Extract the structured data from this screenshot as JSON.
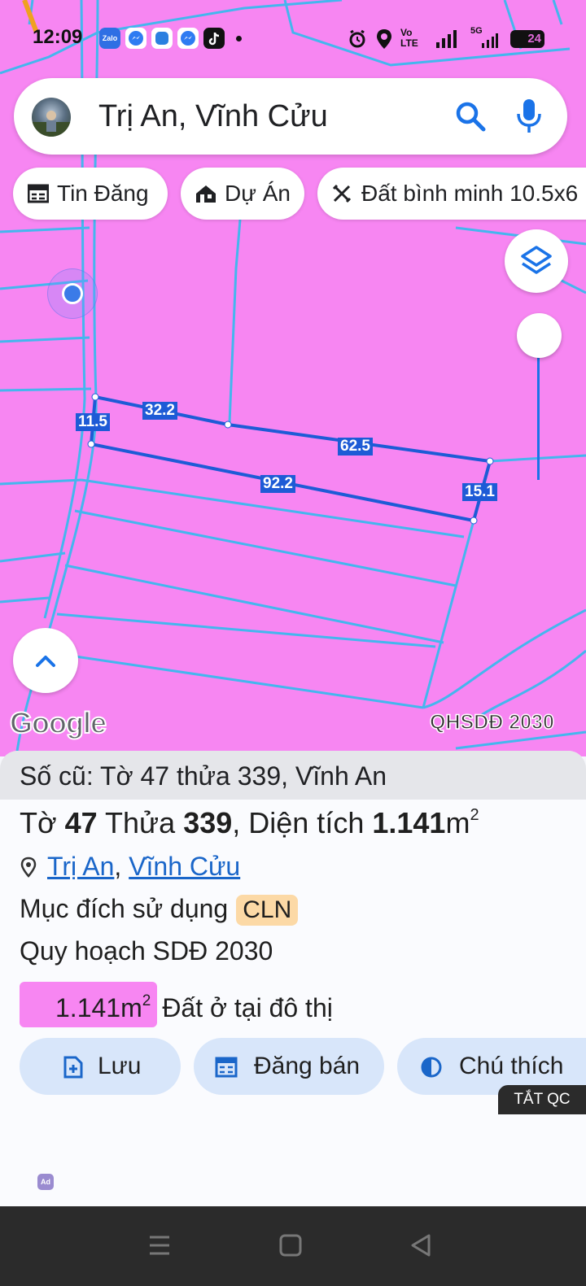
{
  "status_bar": {
    "time": "12:09",
    "apps": [
      "Zalo",
      "messenger-icon",
      "blue-app-icon",
      "messenger-icon",
      "tiktok-icon"
    ],
    "network": "Vo LTE",
    "network2": "5G",
    "battery": "24"
  },
  "search": {
    "query": "Trị An, Vĩnh Cửu"
  },
  "chips": [
    {
      "label": "Tin Đăng",
      "icon": "listing-icon"
    },
    {
      "label": "Dự Án",
      "icon": "project-icon"
    },
    {
      "label": "Đất bình minh 10.5x6",
      "icon": "ruler-icon"
    }
  ],
  "map": {
    "dimensions": [
      "11.5",
      "32.2",
      "62.5",
      "92.2",
      "15.1"
    ],
    "attribution": "Google",
    "overlay_label": "QHSDĐ 2030",
    "colors": {
      "land": "#f786f2",
      "parcel_line": "#44b6ee",
      "selected": "#1e5bd6"
    }
  },
  "sheet": {
    "old_number": "Số cũ: Tờ 47 thửa 339, Vĩnh An",
    "title": {
      "sheet_word": "Tờ",
      "sheet_no": "47",
      "plot_word": "Thửa",
      "plot_no": "339",
      "area_word": ", Diện tích",
      "area_value": "1.141",
      "area_unit": "m",
      "area_exp": "2"
    },
    "location": {
      "commune": "Trị An",
      "separator": ",",
      "district": "Vĩnh Cửu"
    },
    "purpose_label": "Mục đích sử dụng",
    "purpose_code": "CLN",
    "plan_label": "Quy hoạch SDĐ 2030",
    "plan_area": "1.141m",
    "plan_area_exp": "2",
    "plan_type": "Đất ở tại đô thị",
    "actions": [
      {
        "label": "Lưu",
        "icon": "save-icon"
      },
      {
        "label": "Đăng bán",
        "icon": "post-sale-icon"
      },
      {
        "label": "Chú thích",
        "icon": "legend-icon"
      }
    ],
    "ad_close": "TẮT QC",
    "ad_badge": "Ad"
  }
}
